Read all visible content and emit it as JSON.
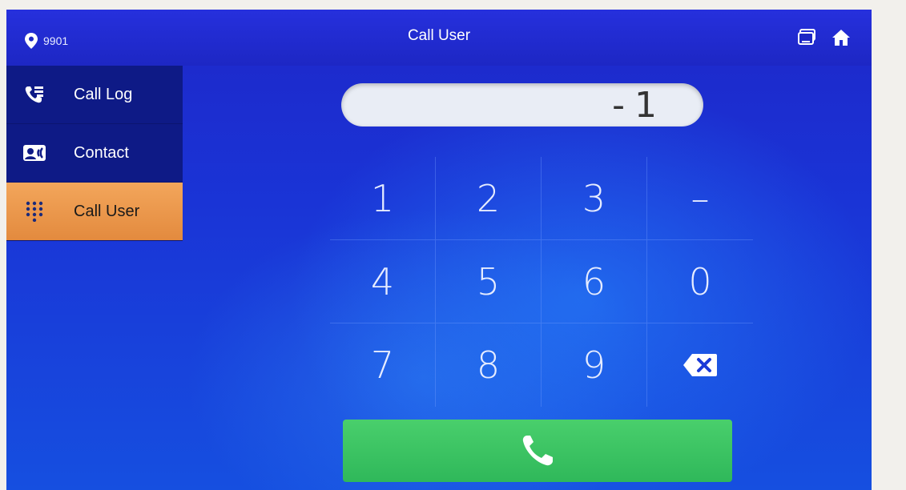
{
  "header": {
    "location": "9901",
    "title": "Call User",
    "location_icon": "location-pin-icon",
    "right_icons": [
      "monitor-icon",
      "home-icon"
    ]
  },
  "sidebar": {
    "items": [
      {
        "label": "Call Log",
        "icon": "call-log-icon",
        "active": false
      },
      {
        "label": "Contact",
        "icon": "contact-card-icon",
        "active": false
      },
      {
        "label": "Call User",
        "icon": "dialpad-icon",
        "active": true
      }
    ]
  },
  "dial_display": {
    "value": "-1"
  },
  "keypad": {
    "keys": [
      "1",
      "2",
      "3",
      "–",
      "4",
      "5",
      "6",
      "0",
      "7",
      "8",
      "9"
    ],
    "backspace_icon": "backspace-icon"
  },
  "call_button": {
    "icon": "phone-icon"
  },
  "colors": {
    "accent_active": "#f3a65b",
    "call_green": "#3ac462",
    "screen_blue": "#1a34d6"
  }
}
